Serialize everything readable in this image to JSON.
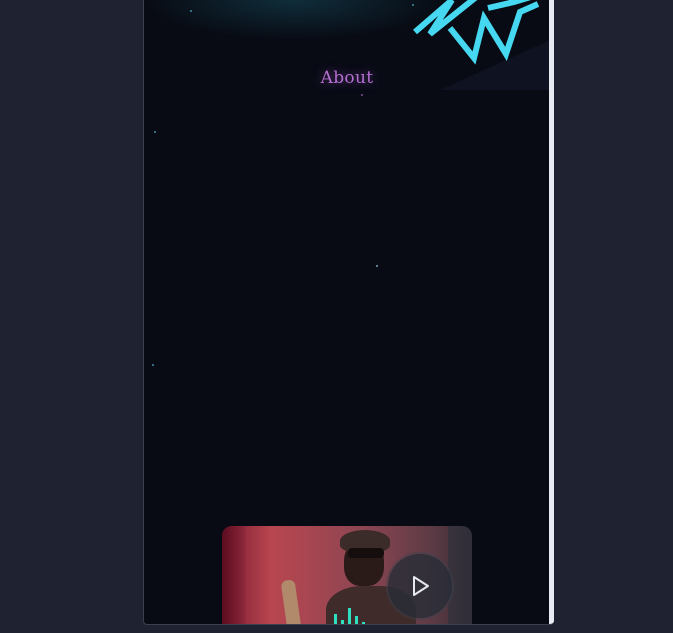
{
  "about": {
    "title": "About"
  },
  "colors": {
    "page_background": "#1f2331",
    "panel_background": "#080b14",
    "title": "#b46fd2",
    "accent_cyan": "#46d8f0",
    "equalizer": "#2ee0c0"
  },
  "icons": {
    "decoration": "geometric-triangles-icon",
    "play": "play-icon",
    "equalizer": "equalizer-icon"
  }
}
